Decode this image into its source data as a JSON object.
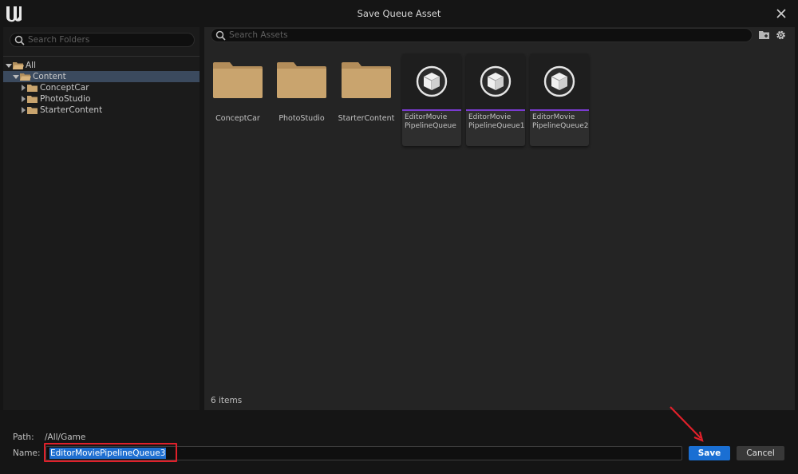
{
  "window": {
    "title": "Save Queue Asset"
  },
  "folder_panel": {
    "search_placeholder": "Search Folders",
    "tree": [
      {
        "label": "All",
        "expanded": true,
        "selected": false
      },
      {
        "label": "Content",
        "expanded": true,
        "selected": true
      },
      {
        "label": "ConceptCar",
        "expanded": false,
        "selected": false
      },
      {
        "label": "PhotoStudio",
        "expanded": false,
        "selected": false
      },
      {
        "label": "StarterContent",
        "expanded": false,
        "selected": false
      }
    ]
  },
  "asset_panel": {
    "search_placeholder": "Search Assets",
    "folders": [
      {
        "label": "ConceptCar"
      },
      {
        "label": "PhotoStudio"
      },
      {
        "label": "StarterContent"
      }
    ],
    "assets": [
      {
        "line1": "EditorMovie",
        "line2": "PipelineQueue"
      },
      {
        "line1": "EditorMovie",
        "line2": "PipelineQueue1"
      },
      {
        "line1": "EditorMovie",
        "line2": "PipelineQueue2"
      }
    ],
    "item_count": "6 items"
  },
  "footer": {
    "path_label": "Path:",
    "path_value": "/All/Game",
    "name_label": "Name:",
    "name_value": "EditorMoviePipelineQueue3",
    "save_label": "Save",
    "cancel_label": "Cancel"
  },
  "colors": {
    "accent_blue": "#1a6fd3",
    "asset_bar": "#7a3bd0",
    "folder": "#c9a46e",
    "highlight_red": "#e0202a"
  },
  "icons": [
    "unreal-logo-icon",
    "close-icon",
    "search-icon",
    "folder-icon",
    "add-folder-icon",
    "settings-gear-icon",
    "asset-cube-icon",
    "red-arrow-annotation"
  ]
}
